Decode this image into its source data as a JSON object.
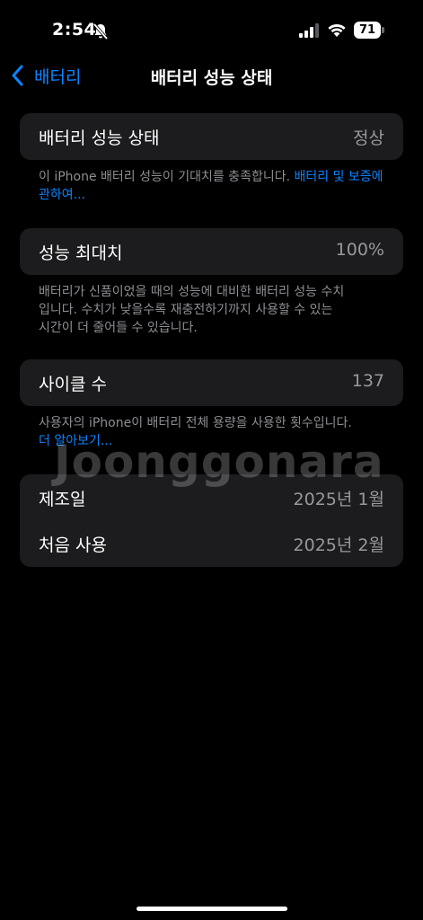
{
  "status_bar": {
    "time": "2:54",
    "battery_level": "71",
    "icons": [
      "bell-slash-icon",
      "cellular-signal-icon",
      "wifi-icon",
      "battery-icon"
    ]
  },
  "nav": {
    "back_label": "배터리",
    "title": "배터리 성능 상태"
  },
  "health_section": {
    "label": "배터리 성능 상태",
    "value": "정상",
    "footnote": "이 iPhone 배터리 성능이 기대치를 충족합니다.",
    "footnote_link": "배터리 및 보증에 관하여..."
  },
  "capacity_section": {
    "label": "성능 최대치",
    "value": "100%",
    "footnote_lines": [
      "배터리가 신품이었을 때의 성능에 대비한 배터리 성능 수치",
      "입니다. 수치가 낮을수록 재충전하기까지 사용할 수 있는",
      "시간이 더 줄어들 수 있습니다."
    ]
  },
  "cycle_section": {
    "label": "사이클 수",
    "value": "137",
    "footnote": "사용자의 iPhone이 배터리 전체 용량을 사용한 횟수입니다.",
    "footnote_link": "더 알아보기..."
  },
  "dates_section": {
    "manufacture_label": "제조일",
    "manufacture_value": "2025년 1월",
    "first_use_label": "처음 사용",
    "first_use_value": "2025년 2월"
  },
  "watermark": "Joonggonara",
  "colors": {
    "accent": "#0a84ff",
    "card_bg": "#1c1c1e",
    "secondary_text": "#8e8e93"
  }
}
